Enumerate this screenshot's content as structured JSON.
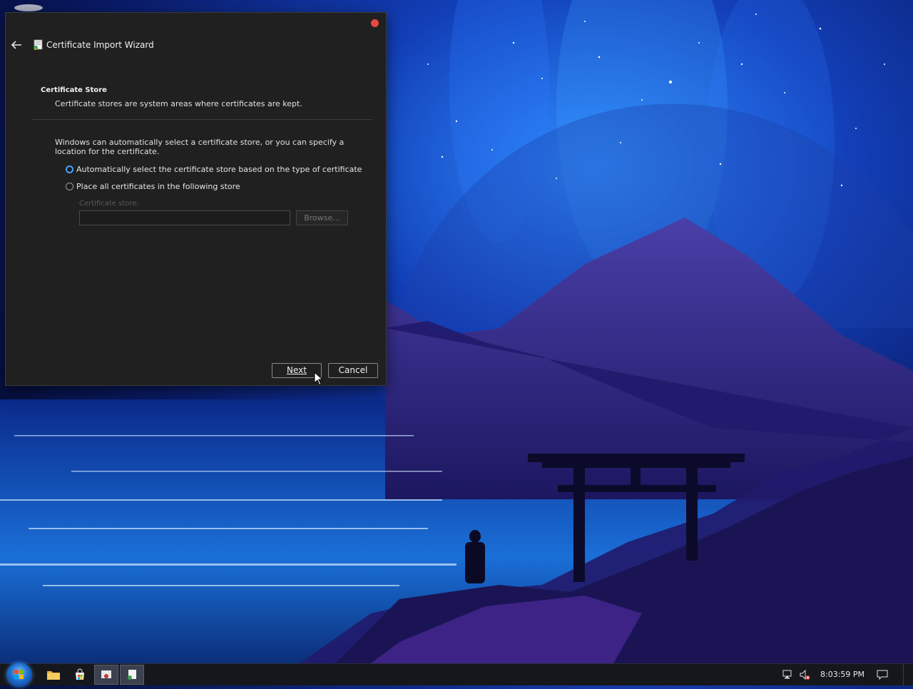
{
  "wizard": {
    "title": "Certificate Import Wizard",
    "section_title": "Certificate Store",
    "section_description": "Certificate stores are system areas where certificates are kept.",
    "intro_text": "Windows can automatically select a certificate store, or you can specify a location for the certificate.",
    "options": [
      {
        "label": "Automatically select the certificate store based on the type of certificate",
        "selected": true
      },
      {
        "label": "Place all certificates in the following store",
        "selected": false
      }
    ],
    "store_label": "Certificate store:",
    "store_value": "",
    "browse_label": "Browse...",
    "next_label": "Next",
    "cancel_label": "Cancel"
  },
  "taskbar": {
    "clock": "8:03:59 PM",
    "pinned": [
      "file-explorer-icon",
      "store-icon",
      "certificate-manager-icon",
      "certificate-wizard-icon"
    ]
  },
  "colors": {
    "accent": "#4aa3ff",
    "dialog_bg": "#202020",
    "close": "#e8483f"
  }
}
